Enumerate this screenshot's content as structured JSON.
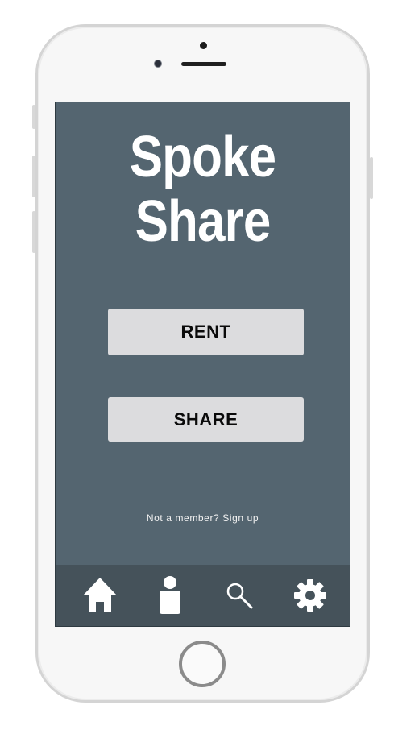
{
  "app": {
    "title_line1": "Spoke",
    "title_line2": "Share"
  },
  "actions": {
    "rent_label": "RENT",
    "share_label": "SHARE"
  },
  "signup": {
    "text": "Not a member? Sign up"
  },
  "tabbar": {
    "items": [
      {
        "icon": "home-icon"
      },
      {
        "icon": "person-icon"
      },
      {
        "icon": "search-icon"
      },
      {
        "icon": "gear-icon"
      }
    ]
  },
  "colors": {
    "screen_background": "#546570",
    "tabbar_background": "#45525a",
    "button_background": "#dcdcde",
    "title_text": "#ffffff"
  }
}
